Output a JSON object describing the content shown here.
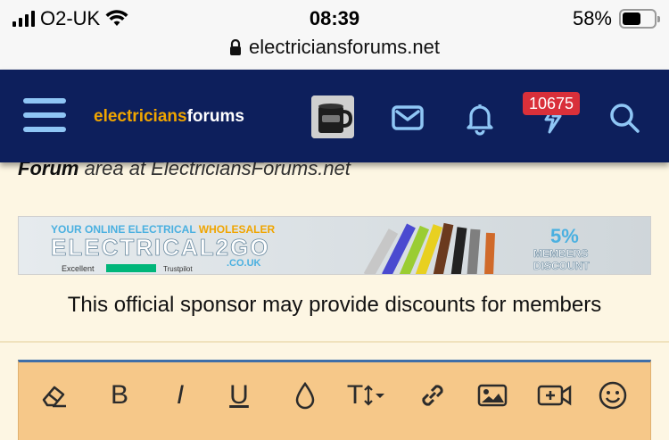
{
  "status_bar": {
    "carrier": "O2-UK",
    "time": "08:39",
    "battery_percent": "58%",
    "battery_level": 0.58,
    "url": "electriciansforums.net"
  },
  "navbar": {
    "logo_part1": "electricians",
    "logo_part2": "forums",
    "notification_badge": "10675"
  },
  "content": {
    "partial_text_bold": "Forum",
    "partial_text_rest": " area at ElectriciansForums.net",
    "banner": {
      "top_line_1": "YOUR ONLINE ELECTRICAL ",
      "top_line_2": "WHOLESALER",
      "brand": "ELECTRICAL2GO",
      "domain": ".CO.UK",
      "rating_label": "Excellent",
      "trustpilot": "Trustpilot",
      "discount_pct": "5%",
      "discount_line1": "MEMBERS",
      "discount_line2": "DISCOUNT"
    },
    "sponsor_text": "This official sponsor may provide discounts for members"
  },
  "editor_toolbar": {
    "bold_label": "B",
    "italic_label": "I",
    "underline_label": "U",
    "text_size_label": "T"
  },
  "colors": {
    "navbar": "#0d1f5c",
    "accent_orange": "#f0a500",
    "badge": "#d9303a",
    "editor_bg": "#f6c889",
    "page_bg": "#fdf6e3"
  }
}
